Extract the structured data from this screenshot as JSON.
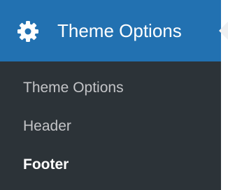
{
  "menu": {
    "title": "Theme Options",
    "icon": "gear-icon",
    "submenu": [
      {
        "label": "Theme Options",
        "current": false
      },
      {
        "label": "Header",
        "current": false
      },
      {
        "label": "Footer",
        "current": true
      }
    ]
  },
  "colors": {
    "header_bg": "#2271b1",
    "submenu_bg": "#2c3338",
    "submenu_text": "#c3c4c7",
    "submenu_current_text": "#ffffff"
  }
}
